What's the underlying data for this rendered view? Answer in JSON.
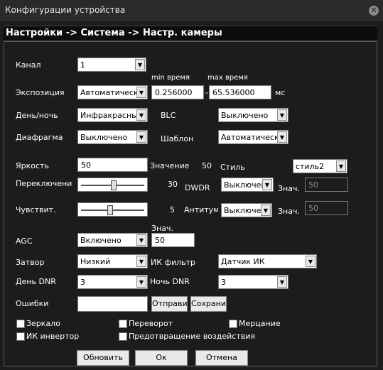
{
  "window": {
    "title": "Конфигурации устройства",
    "close_glyph": "✕"
  },
  "breadcrumb": "Настройки -> Система -> Настр. камеры",
  "labels": {
    "channel": "Канал",
    "exposure": "Экспозиция",
    "min_time": "min время",
    "max_time": "max время",
    "ms": "мс",
    "day_night": "День/ночь",
    "blc": "BLC",
    "iris": "Диафрагма",
    "template": "Шаблон",
    "brightness": "Яркость",
    "value": "Значение",
    "style": "Стиль",
    "switch": "Переключение Д/Н",
    "dwdr": "DWDR",
    "znach": "Знач.",
    "sensitivity": "Чувствит.",
    "antifog": "Антитума",
    "agc": "AGC",
    "agc_znach": "Знач.",
    "shutter": "Затвор",
    "ir_filter": "ИК фильтр",
    "day_dnr": "День DNR",
    "night_dnr": "Ночь DNR",
    "errors": "Ошибки"
  },
  "fields": {
    "channel": "1",
    "exposure": "Автоматически",
    "min_time": "0.256000",
    "max_time": "65.536000",
    "day_night": "Инфракрасный",
    "blc": "Выключено",
    "iris": "Выключено",
    "template": "Автоматически",
    "brightness": "50",
    "brightness_value": "50",
    "style": "стиль2",
    "switch_value": "30",
    "dwdr": "Выключено",
    "dwdr_znach": "50",
    "sensitivity_value": "5",
    "antifog": "Выключено",
    "antifog_znach": "50",
    "agc": "Включено",
    "agc_znach": "50",
    "shutter": "Низкий",
    "ir_filter": "Датчик ИК",
    "day_dnr": "3",
    "night_dnr": "3",
    "errors": ""
  },
  "sliders": {
    "switch_level": 0.5,
    "sensitivity_level": 0.45
  },
  "buttons": {
    "send": "Отправить",
    "save": "Сохранить",
    "refresh": "Обновить",
    "ok": "Ок",
    "cancel": "Отмена"
  },
  "checkboxes": {
    "mirror": "Зеркало",
    "flip": "Переворот",
    "flicker": "Мерцание",
    "ir_invert": "ИК инвертор",
    "anti_tamper": "Предотвращение воздействия"
  },
  "icons": {
    "dropdown_arrow": "▼"
  },
  "colors": {
    "background": "#1c1c1c",
    "titlebar": "#2a2a2a",
    "input_bg": "#ffffff"
  }
}
